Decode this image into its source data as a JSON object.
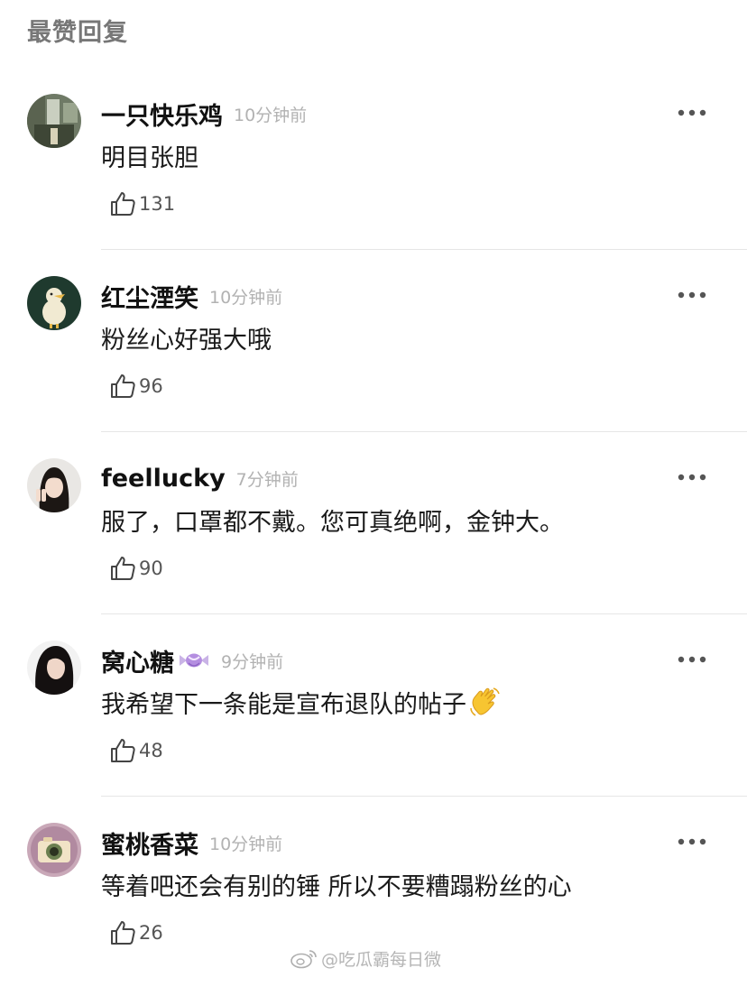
{
  "section": {
    "title": "最赞回复"
  },
  "comments": [
    {
      "username": "一只快乐鸡",
      "time": "10分钟前",
      "text": "明目张胆",
      "likes": "131",
      "avatar_icon": "avatar-photo-room"
    },
    {
      "username": "红尘湮笑",
      "time": "10分钟前",
      "text": "粉丝心好强大哦",
      "likes": "96",
      "avatar_icon": "avatar-duck-green"
    },
    {
      "username": "feellucky",
      "time": "7分钟前",
      "text": "服了，口罩都不戴。您可真绝啊，金钟大。",
      "likes": "90",
      "avatar_icon": "avatar-girl-peace-sign"
    },
    {
      "username": "窝心糖",
      "time": "9分钟前",
      "text": "我希望下一条能是宣布退队的帖子",
      "likes": "48",
      "avatar_icon": "avatar-girl-dark-hair",
      "name_badge_icon": "candy-icon",
      "text_emoji_icon": "waving-hand-icon"
    },
    {
      "username": "蜜桃香菜",
      "time": "10分钟前",
      "text": "等着吧还会有别的锤 所以不要糟蹋粉丝的心",
      "likes": "26",
      "avatar_icon": "avatar-camera-lens"
    }
  ],
  "watermark": {
    "text": "@吃瓜霸每日微"
  },
  "colors": {
    "title_gray": "#777777",
    "time_gray": "#b2b2b2",
    "divider": "#e6e6e6",
    "text": "#1a1a1a"
  }
}
